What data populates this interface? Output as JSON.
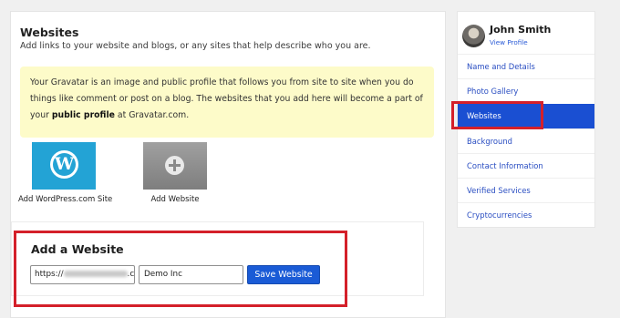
{
  "main": {
    "title": "Websites",
    "description": "Add links to your website and blogs, or any sites that help describe who you are.",
    "notice": {
      "text_before": "Your Gravatar is an image and public profile that follows you from site to site when you do things like comment or post on a blog. The websites that you add here will become a part of your ",
      "bold": "public profile",
      "text_after": " at Gravatar.com."
    },
    "tiles": {
      "wordpress_label": "Add WordPress.com Site",
      "add_label": "Add Website",
      "wordpress_icon": "wordpress-logo-icon",
      "add_icon": "plus-circle-icon"
    },
    "add_form": {
      "title": "Add a Website",
      "url_prefix": "https://",
      "url_suffix": ".com/",
      "name_value": "Demo Inc",
      "save_label": "Save Website"
    }
  },
  "sidebar": {
    "user_name": "John Smith",
    "view_profile": "View Profile",
    "items": [
      {
        "label": "Name and Details"
      },
      {
        "label": "Photo Gallery"
      },
      {
        "label": "Websites",
        "active": true
      },
      {
        "label": "Background"
      },
      {
        "label": "Contact Information"
      },
      {
        "label": "Verified Services"
      },
      {
        "label": "Cryptocurrencies"
      }
    ]
  },
  "colors": {
    "accent": "#1a4fd2",
    "highlight": "#d4202a",
    "notice_bg": "#fdfbc9",
    "wordpress_blue": "#23a3d5"
  }
}
